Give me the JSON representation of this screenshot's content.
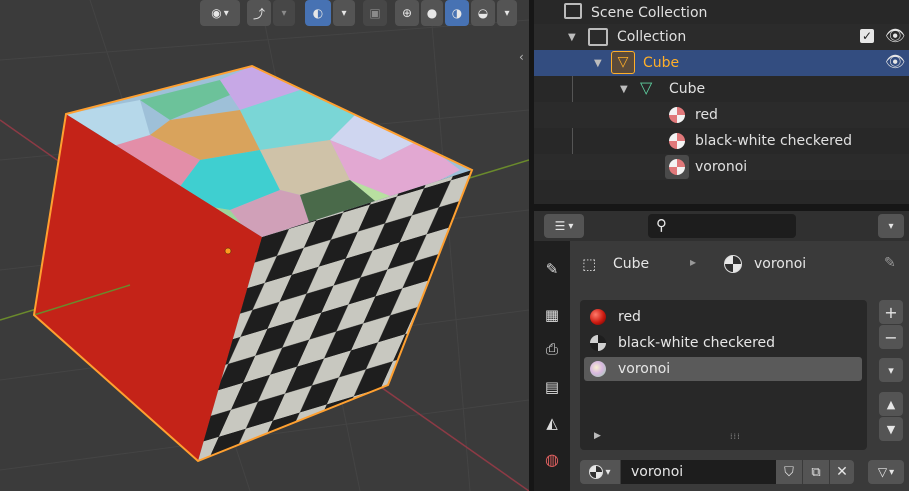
{
  "viewport": {
    "header_buttons": [
      "view-object-types",
      "selectability-visibility",
      "gizmo-toggle",
      "overlays-toggle",
      "xray-toggle",
      "shading-wireframe",
      "shading-solid",
      "shading-material-preview",
      "shading-rendered"
    ],
    "colors": {
      "background": "#3b3b3b",
      "grid_x_axis": "#8c3a45",
      "grid_y_axis": "#6a8a2c",
      "selection_outline": "#ffa030",
      "red_face": "#c42318",
      "checker_dark": "#1e1e1e",
      "checker_light": "#c8c8c0"
    }
  },
  "outliner": {
    "rows": [
      {
        "label": "Scene Collection",
        "icon": "scene-collection-icon"
      },
      {
        "label": "Collection",
        "icon": "collection-icon"
      },
      {
        "label": "Cube",
        "icon": "object-mesh-icon",
        "selected": true
      },
      {
        "label": "Cube",
        "icon": "mesh-data-icon"
      },
      {
        "label": "red",
        "icon": "material-icon"
      },
      {
        "label": "black-white checkered",
        "icon": "material-icon"
      },
      {
        "label": "voronoi",
        "icon": "material-icon"
      }
    ]
  },
  "properties": {
    "breadcrumb": {
      "object": "Cube",
      "material": "voronoi"
    },
    "slots": [
      {
        "label": "red",
        "color": "#cc1a10"
      },
      {
        "label": "black-white checkered",
        "color": "#bdbdbd"
      },
      {
        "label": "voronoi",
        "color": "#e0c8e8",
        "selected": true
      }
    ],
    "material_name": "voronoi"
  }
}
